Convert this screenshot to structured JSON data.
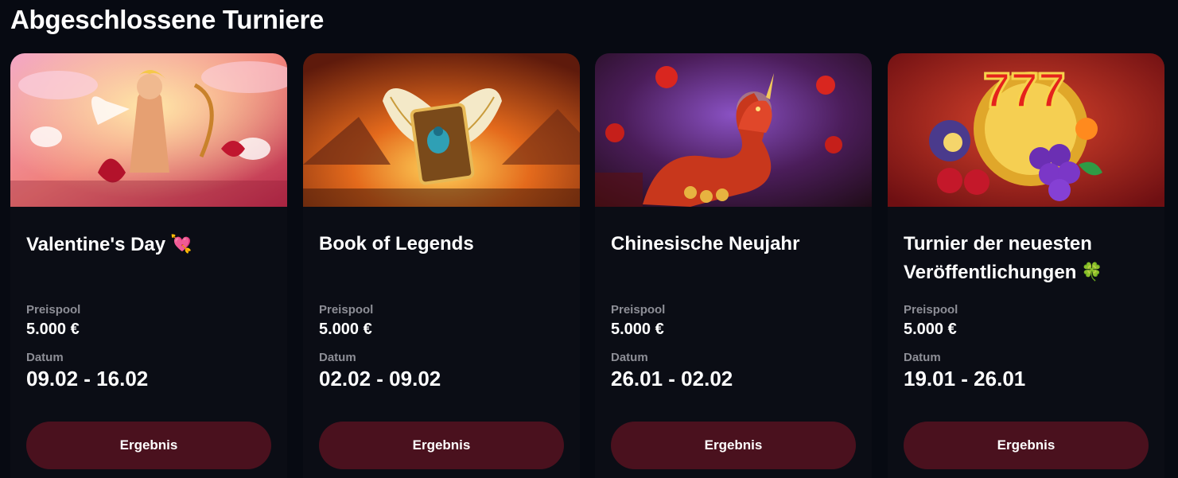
{
  "page": {
    "title": "Abgeschlossene Turniere"
  },
  "tournaments": [
    {
      "title": "Valentine's Day",
      "emoji": "💘",
      "pool_label": "Preispool",
      "pool_value": "5.000 €",
      "date_label": "Datum",
      "date_value": "09.02 - 16.02",
      "button_label": "Ergebnis",
      "image_icon": "cupid-banner-image"
    },
    {
      "title": "Book of Legends",
      "emoji": "",
      "pool_label": "Preispool",
      "pool_value": "5.000 €",
      "date_label": "Datum",
      "date_value": "02.02 - 09.02",
      "button_label": "Ergebnis",
      "image_icon": "winged-book-banner-image"
    },
    {
      "title": "Chinesische Neujahr",
      "emoji": "",
      "pool_label": "Preispool",
      "pool_value": "5.000 €",
      "date_label": "Datum",
      "date_value": "26.01 - 02.02",
      "button_label": "Ergebnis",
      "image_icon": "dragon-banner-image"
    },
    {
      "title": "Turnier der neuesten Veröffentlichungen",
      "emoji": "🍀",
      "pool_label": "Preispool",
      "pool_value": "5.000 €",
      "date_label": "Datum",
      "date_value": "19.01 - 26.01",
      "button_label": "Ergebnis",
      "image_icon": "fruit-slots-banner-image"
    }
  ],
  "colors": {
    "background": "#070a12",
    "card": "#0b0d15",
    "button": "#4a111e",
    "muted_text": "#8d8e96"
  }
}
